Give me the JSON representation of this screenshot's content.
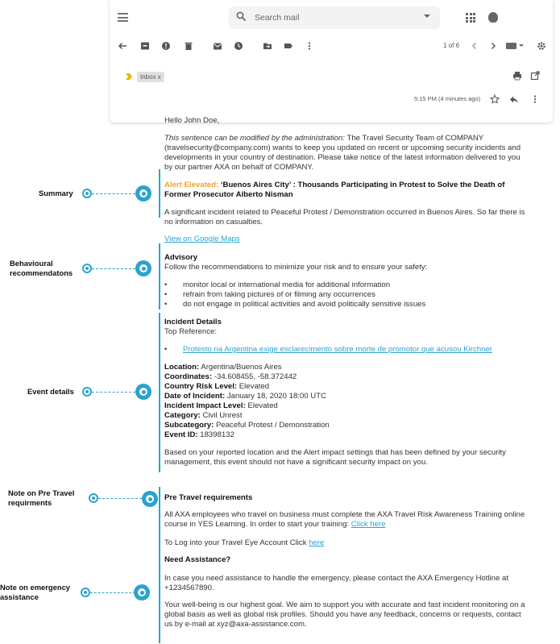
{
  "search": {
    "placeholder": "Search mail"
  },
  "toolbar": {
    "pager": "1 of 6"
  },
  "labels": {
    "inbox_chip": "Inbox x"
  },
  "message_meta": {
    "timestamp": "5:15 PM (4 minutes ago)"
  },
  "email": {
    "greeting": "Hello John Doe,",
    "intro_italic": "This sentence can be modified by the administration:",
    "intro_rest": " The Travel Security Team of COMPANY (travelsecurity@company.com) wants to keep you updated on recent or upcoming security incidents and developments in your country of destination. Please take notice of the latest information delivered to you by our partner AXA on behalf of COMPANY.",
    "alert_prefix": "Alert Elevated:",
    "alert_title": " ‘Buenos Aires City’ : Thousands Participating in Protest to Solve the Death of Former Prosecutor Alberto Nisman",
    "summary_text": "A significant incident related to Peaceful Protest / Demonstration occurred in Buenos Aires. So far there is no information on casualties.",
    "maps_link": "View on Google Maps",
    "advisory_heading": "Advisory",
    "advisory_intro": "Follow the recommendations to minimize your risk and to ensure your safety:",
    "advisory_items": [
      "monitor local or international media for additional information",
      "refrain from taking pictures of or filming any occurrences",
      "do not engage in political activities and avoid politically sensitive issues"
    ],
    "incident_heading": "Incident Details",
    "top_reference_label": "Top Reference:",
    "reference_link": "Protesto na Argentina exige esclarecimento sobre morte de promotor que acusou Kirchner",
    "details": [
      {
        "label": "Location:",
        "value": " Argentina/Buenos Aires"
      },
      {
        "label": "Coordinates:",
        "value": " -34.608455, -58.372442"
      },
      {
        "label": "Country Risk Level:",
        "value": " Elevated"
      },
      {
        "label": "Date of Incident:",
        "value": " January 18, 2020 18:00 UTC"
      },
      {
        "label": "Incident Impact Level:",
        "value": " Elevated"
      },
      {
        "label": "Category:",
        "value": " Civil Unrest"
      },
      {
        "label": "Subcategory:",
        "value": " Peaceful Protest / Demonstration"
      },
      {
        "label": "Event ID:",
        "value": " 18398132"
      }
    ],
    "impact_text": "Based on your reported location and the Alert impact settings that has been defined by your security management, this event should not have a significant security impact on you.",
    "pretravel_heading": "Pre Travel requirements",
    "pretravel_text": "All AXA employees who travel on business must complete the AXA Travel Risk Awareness Training online course in YES Learning. In order to start your training: ",
    "pretravel_link": "Click here",
    "login_text": "To Log into your Travel Eye Account Click ",
    "login_link": "here",
    "assistance_heading": "Need Assistance?",
    "assistance_text": "In case you need assistance to handle the emergency, please contact the AXA Emergency Hotline at +1234567890.",
    "wellbeing_text": "Your well-being is our highest goal. We aim to support you with accurate and fast incident monitoring on a global basis as well as global risk profiles. Should you have any feedback, concerns or requests, contact us by e-mail at xyz@axa-assistance.com."
  },
  "callouts": [
    {
      "label": "Summary"
    },
    {
      "label": "Behavioural recommendatons"
    },
    {
      "label": "Event details"
    },
    {
      "label": "Note on Pre Travel requirments"
    },
    {
      "label": "Note on emergency assistance"
    }
  ],
  "colors": {
    "accent": "#2aa3d0",
    "alert": "#f0a030"
  }
}
